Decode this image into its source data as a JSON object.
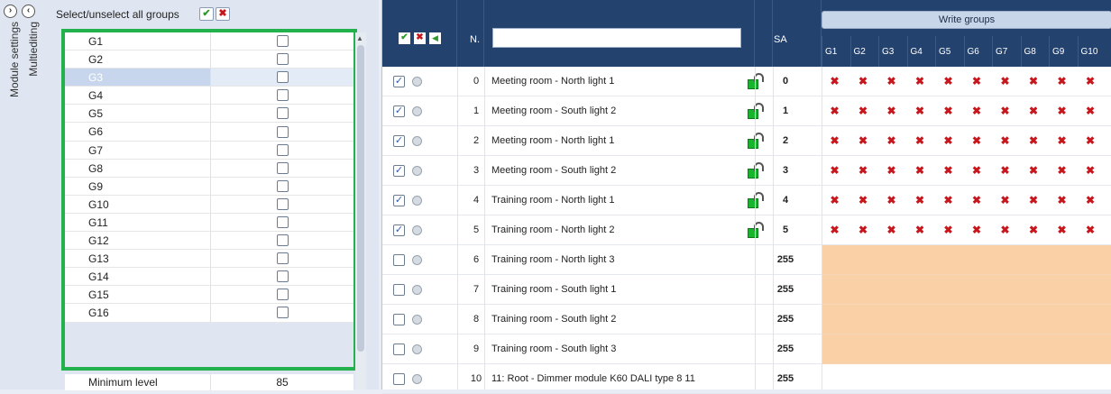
{
  "left_panel": {
    "tabs": [
      "Module settings",
      "Multiediting"
    ],
    "select_all_label": "Select/unselect all groups",
    "groups": [
      "G1",
      "G2",
      "G3",
      "G4",
      "G5",
      "G6",
      "G7",
      "G8",
      "G9",
      "G10",
      "G11",
      "G12",
      "G13",
      "G14",
      "G15",
      "G16"
    ],
    "selected_group": "G3",
    "minimum_level": {
      "label": "Minimum level",
      "value": "85"
    }
  },
  "grid": {
    "header": {
      "n_label": "N.",
      "sa_label": "SA",
      "write_groups_label": "Write groups",
      "group_cols": [
        "G1",
        "G2",
        "G3",
        "G4",
        "G5",
        "G6",
        "G7",
        "G8",
        "G9",
        "G10"
      ]
    },
    "rows": [
      {
        "n": "0",
        "name": "Meeting room - North light 1",
        "sa": "0",
        "checked": true,
        "locked": true,
        "write": "x"
      },
      {
        "n": "1",
        "name": "Meeting room - South light  2",
        "sa": "1",
        "checked": true,
        "locked": true,
        "write": "x"
      },
      {
        "n": "2",
        "name": "Meeting room - North light  1",
        "sa": "2",
        "checked": true,
        "locked": true,
        "write": "x"
      },
      {
        "n": "3",
        "name": "Meeting room - South light  2",
        "sa": "3",
        "checked": true,
        "locked": true,
        "write": "x"
      },
      {
        "n": "4",
        "name": "Training room - North light 1",
        "sa": "4",
        "checked": true,
        "locked": true,
        "write": "x"
      },
      {
        "n": "5",
        "name": "Training room - North light 2",
        "sa": "5",
        "checked": true,
        "locked": true,
        "write": "x"
      },
      {
        "n": "6",
        "name": "Training room - North light 3",
        "sa": "255",
        "checked": false,
        "locked": false,
        "write": "orange"
      },
      {
        "n": "7",
        "name": "Training room - South light 1",
        "sa": "255",
        "checked": false,
        "locked": false,
        "write": "orange"
      },
      {
        "n": "8",
        "name": "Training room - South light 2",
        "sa": "255",
        "checked": false,
        "locked": false,
        "write": "orange"
      },
      {
        "n": "9",
        "name": "Training room - South light 3",
        "sa": "255",
        "checked": false,
        "locked": false,
        "write": "orange"
      },
      {
        "n": "10",
        "name": "11: Root - Dimmer module K60  DALI type 8 11",
        "sa": "255",
        "checked": false,
        "locked": false,
        "write": "none"
      }
    ]
  },
  "colors": {
    "header_bg": "#24426e",
    "highlight": "#23b14d",
    "orange": "#fad1a6",
    "x_red": "#c8161d"
  }
}
